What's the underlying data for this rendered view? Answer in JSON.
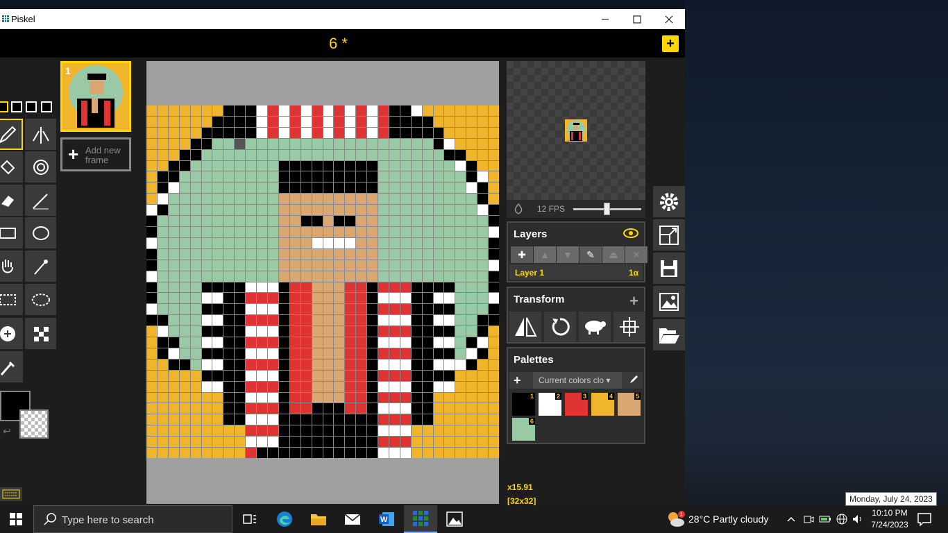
{
  "window": {
    "app_title": "Piskel"
  },
  "header": {
    "title": "6 *",
    "add_label": "+"
  },
  "frames": {
    "frame_number": "1",
    "add_frame_label": "Add new frame"
  },
  "preview": {
    "fps_label": "12 FPS"
  },
  "layers": {
    "title": "Layers",
    "layer_name": "Layer 1",
    "layer_opacity": "1α"
  },
  "transform": {
    "title": "Transform"
  },
  "palettes": {
    "title": "Palettes",
    "selected": "Current colors clo",
    "colors": [
      {
        "n": "1",
        "hex": "#000000"
      },
      {
        "n": "2",
        "hex": "#ffffff"
      },
      {
        "n": "3",
        "hex": "#e03434"
      },
      {
        "n": "4",
        "hex": "#f0b52a"
      },
      {
        "n": "5",
        "hex": "#d9a872"
      },
      {
        "n": "6",
        "hex": "#9ac9a6"
      }
    ]
  },
  "cursor": {
    "zoom": "x15.91",
    "size": "[32x32]"
  },
  "colors": {
    "primary": "#000000",
    "secondary": "transparent",
    "accent": "#ffd700"
  },
  "taskbar": {
    "search_placeholder": "Type here to search",
    "temperature": "28°C",
    "weather": "Partly cloudy",
    "time": "10:10 PM",
    "date": "7/24/2023",
    "weather_badge": "1"
  },
  "tooltip": {
    "text": "Monday, July 24, 2023"
  }
}
